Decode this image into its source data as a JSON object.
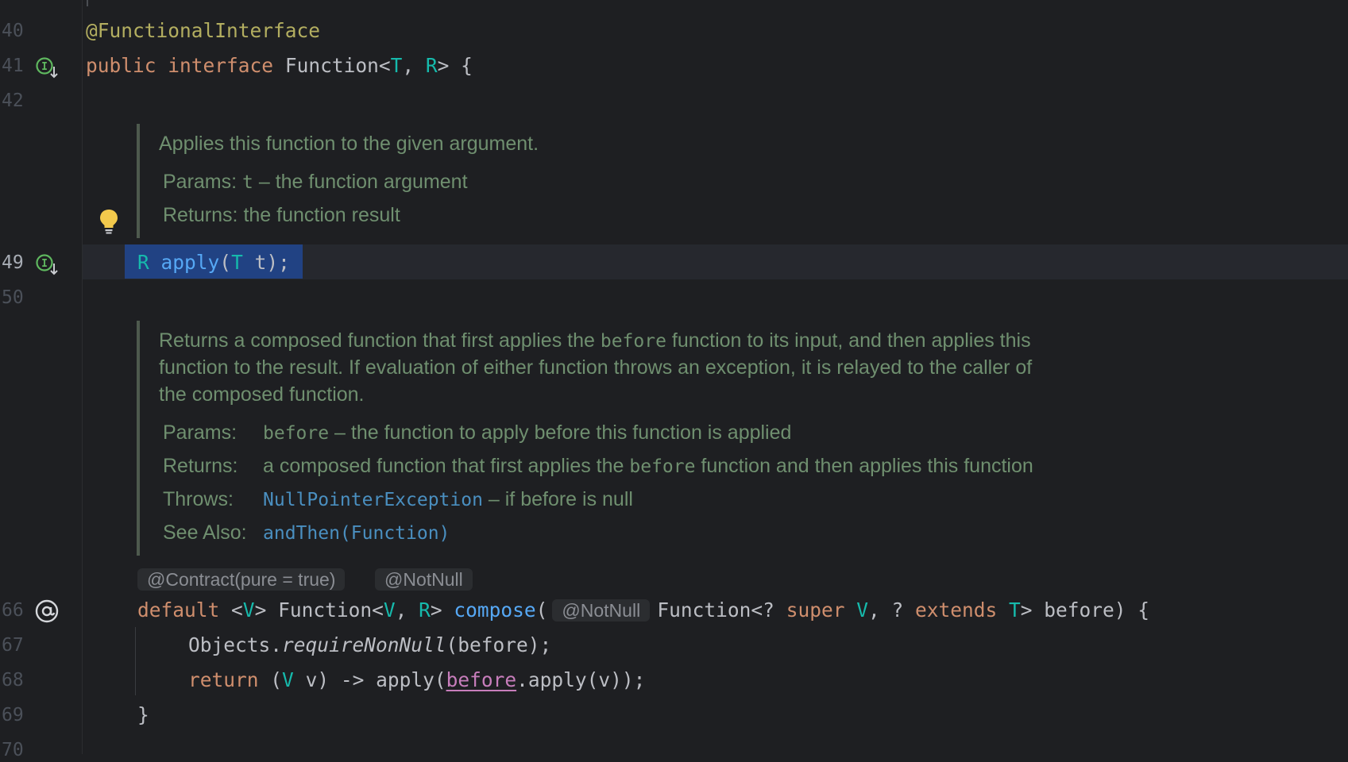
{
  "colors": {
    "background": "#1e1f22",
    "keyword": "#cf8e6d",
    "type_param": "#16baac",
    "annotation": "#b3ae60",
    "method": "#56a8f5",
    "doc_text": "#6f8f6f",
    "doc_link": "#4a8fc0",
    "selection": "#214283"
  },
  "line_numbers": {
    "l40": "40",
    "l41": "41",
    "l42": "42",
    "l49": "49",
    "l50": "50",
    "l66": "66",
    "l67": "67",
    "l68": "68",
    "l69": "69",
    "l70": "70"
  },
  "gutter_icons": {
    "l41": "implemented-interface-icon",
    "l49": "implemented-method-icon",
    "intention": "lightbulb-icon",
    "l66": "at-annotation-icon"
  },
  "code": {
    "l40": {
      "annotation": "@FunctionalInterface"
    },
    "l41": {
      "kw_public": "public",
      "kw_interface": "interface",
      "name": "Function",
      "lt": "<",
      "t": "T",
      "comma": ", ",
      "r": "R",
      "gt_brace": "> {"
    },
    "l49": {
      "r": "R",
      "method": "apply",
      "open": "(",
      "t": "T",
      "rest": " t);"
    },
    "l66": {
      "kw_default": "default",
      "generic_open": "<",
      "v1": "V",
      "generic_close": "> Function<",
      "v2": "V",
      "comma": ", ",
      "r": "R",
      "gt": "> ",
      "method": "compose",
      "open": "(",
      "inlay": "@NotNull",
      "p1": "Function<? ",
      "kw_super": "super",
      "v3": "V",
      "p2": ", ? ",
      "kw_extends": "extends",
      "t": "T",
      "p3": "> before) {"
    },
    "l67": {
      "obj": "Objects.",
      "method": "requireNonNull",
      "rest": "(before);"
    },
    "l68": {
      "kw_return": "return",
      "open": "(",
      "v1": "V",
      "mid": " v) -> apply(",
      "before": "before",
      "rest": ".apply(v));"
    },
    "l69": {
      "brace": "}"
    }
  },
  "doc1": {
    "summary": "Applies this function to the given argument.",
    "params_label": "Params:",
    "params_name": "t",
    "params_desc": " – the function argument",
    "returns_label": "Returns:",
    "returns_desc": "the function result"
  },
  "doc2": {
    "summary_1a": "Returns a composed function that first applies the ",
    "summary_1b": "before",
    "summary_1c": " function to its input, and then applies this",
    "summary_2": "function to the result. If evaluation of either function throws an exception, it is relayed to the caller of",
    "summary_3": "the composed function.",
    "params_label": "Params:",
    "params_name": "before",
    "params_desc": " – the function to apply before this function is applied",
    "returns_label": "Returns:",
    "returns_a": "a composed function that first applies the ",
    "returns_b": "before",
    "returns_c": " function and then applies this function",
    "throws_label": "Throws:",
    "throws_link": "NullPointerException",
    "throws_desc": " – if before is null",
    "see_label": "See Also:",
    "see_link": "andThen(Function)"
  },
  "inlays": {
    "contract": "@Contract(pure = true)",
    "notnull": "@NotNull"
  }
}
